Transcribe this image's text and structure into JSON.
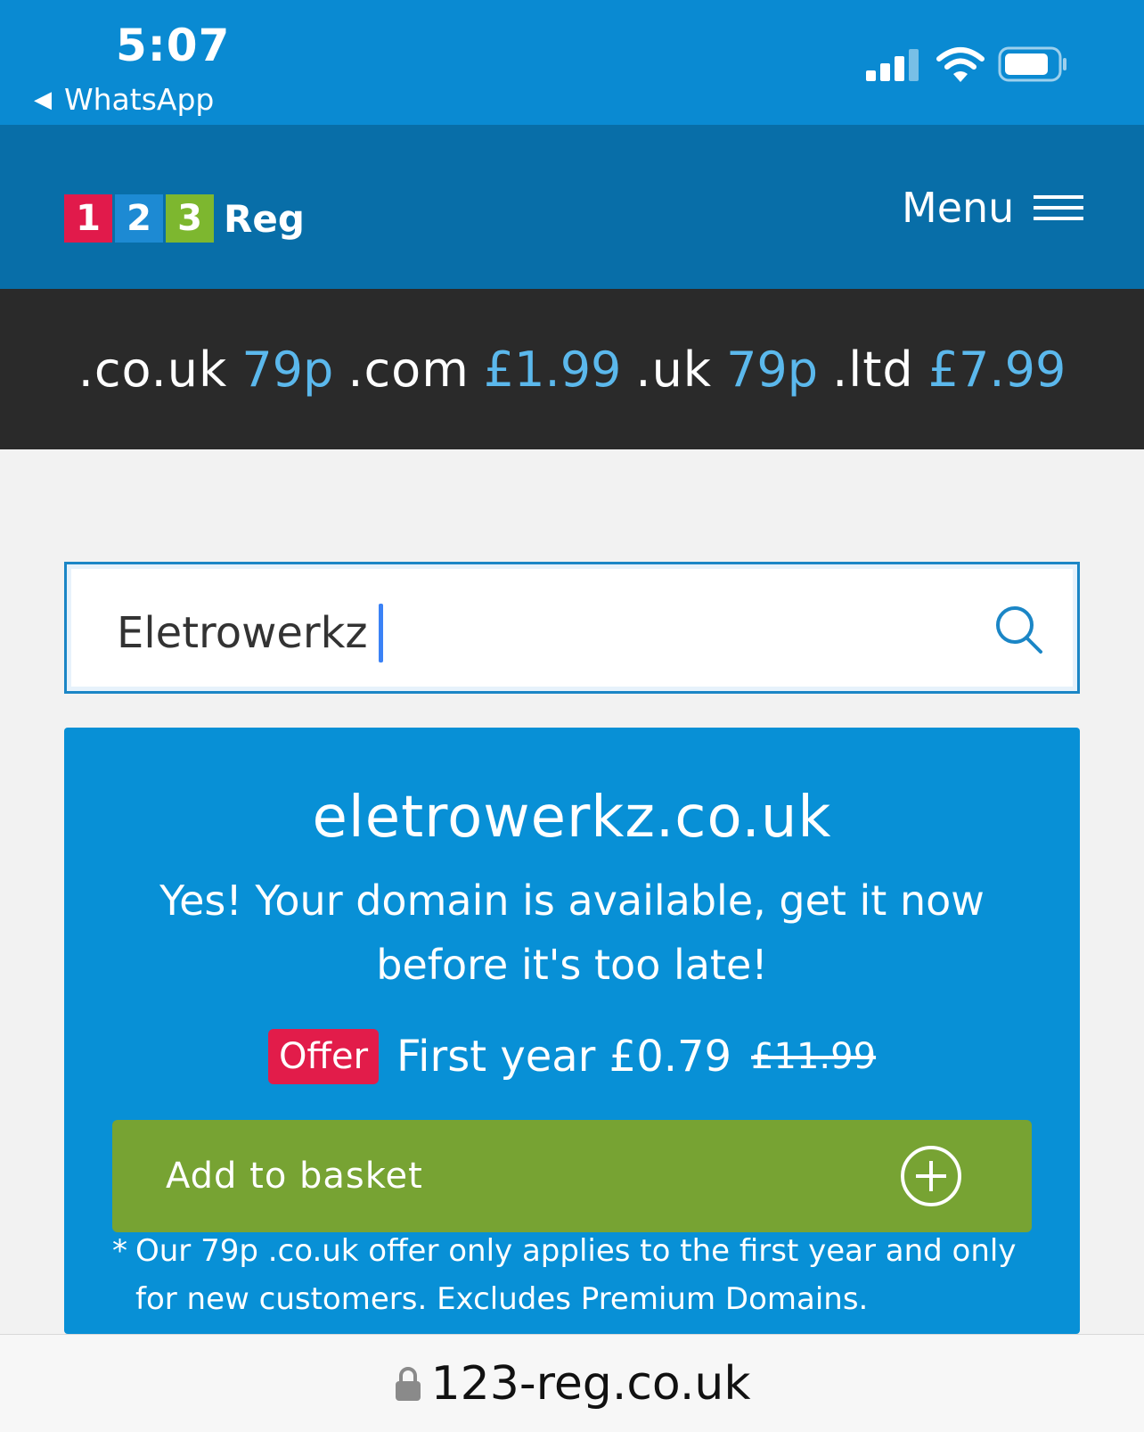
{
  "status_bar": {
    "time": "5:07",
    "back_app": "WhatsApp",
    "icons": [
      "cellular-signal-icon",
      "wifi-icon",
      "battery-icon"
    ]
  },
  "header": {
    "logo": {
      "box1": "1",
      "box2": "2",
      "box3": "3",
      "text": "Reg"
    },
    "menu_label": "Menu"
  },
  "tld_prices": [
    {
      "tld": ".co.uk",
      "price": "79p"
    },
    {
      "tld": ".com",
      "price": "£1.99"
    },
    {
      "tld": ".uk",
      "price": "79p"
    },
    {
      "tld": ".ltd",
      "price": "£7.99"
    }
  ],
  "search": {
    "value": "Eletrowerkz"
  },
  "result": {
    "domain": "eletrowerkz.co.uk",
    "message": "Yes! Your domain is available, get it now before it's too late!",
    "offer_badge": "Offer",
    "first_year_text": "First year £0.79",
    "old_price": "£11.99",
    "basket_label": "Add to basket",
    "note_star": "*",
    "note": "Our 79p .co.uk offer only applies to the first year and only for new customers. Excludes Premium Domains."
  },
  "url_bar": {
    "url": "123-reg.co.uk"
  },
  "colors": {
    "status_blue": "#0a8ad2",
    "header_blue": "#086ea8",
    "tld_bar": "#2a2a2a",
    "price_blue": "#5bb8ec",
    "card_blue": "#0890d6",
    "basket_green": "#77a333",
    "offer_red": "#e21c4a",
    "logo_red": "#e11a4b",
    "logo_blue": "#1d8ad3",
    "logo_green": "#7db72f"
  }
}
